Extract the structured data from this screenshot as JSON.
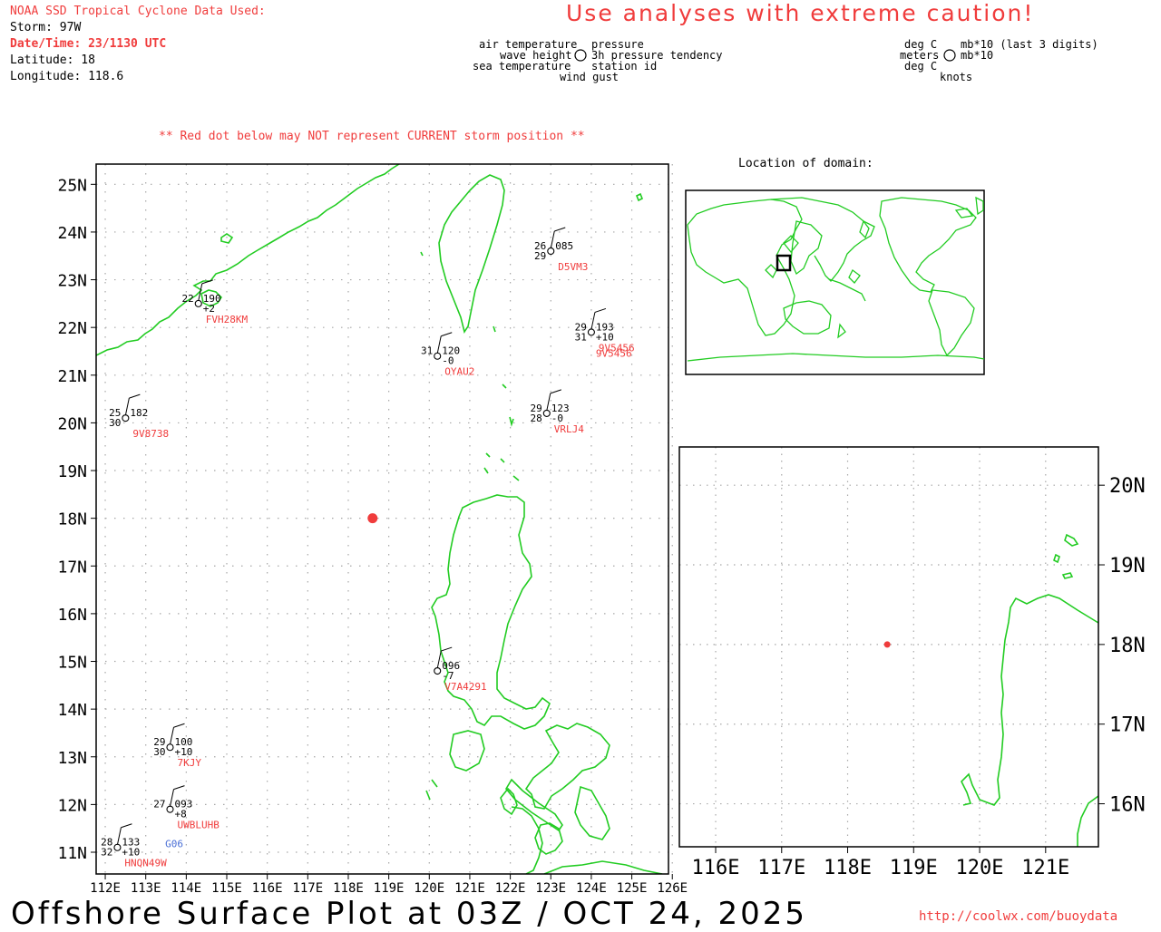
{
  "header": {
    "source": "NOAA SSD Tropical Cyclone Data Used:",
    "storm": "Storm: 97W",
    "datetime": "Date/Time: 23/1130 UTC",
    "latitude": "Latitude: 18",
    "longitude": "Longitude: 118.6",
    "warning": "Use analyses with extreme caution!"
  },
  "legend": {
    "air_temperature": "air temperature",
    "wave_height": "wave height",
    "sea_temperature": "sea temperature",
    "pressure": "pressure",
    "pressure_tendency": "3h pressure tendency",
    "station_id": "station id",
    "wind_gust": "wind gust",
    "unit_deg_c_1": "deg C",
    "unit_meters": "meters",
    "unit_deg_c_2": "deg C",
    "unit_mb_last3": "mb*10 (last 3 digits)",
    "unit_mb": "mb*10",
    "unit_knots": "knots"
  },
  "notice": "** Red dot below may NOT represent CURRENT storm position **",
  "inset_title": "Location of domain:",
  "storm_position": {
    "lat": 18.0,
    "lon": 118.6,
    "color": "#f03c3c"
  },
  "main_map": {
    "lat_labels": [
      "25N",
      "24N",
      "23N",
      "22N",
      "21N",
      "20N",
      "19N",
      "18N",
      "17N",
      "16N",
      "15N",
      "14N",
      "13N",
      "12N",
      "11N"
    ],
    "lon_labels": [
      "112E",
      "113E",
      "114E",
      "115E",
      "116E",
      "117E",
      "118E",
      "119E",
      "120E",
      "121E",
      "122E",
      "123E",
      "124E",
      "125E",
      "126E"
    ]
  },
  "zoom_map": {
    "lat_labels": [
      "20N",
      "19N",
      "18N",
      "17N",
      "16N"
    ],
    "lon_labels": [
      "116E",
      "117E",
      "118E",
      "119E",
      "120E",
      "121E"
    ]
  },
  "stations": [
    {
      "id": "D5VM3",
      "lat": 23.6,
      "lon": 123.0,
      "air": "26",
      "sea": "29",
      "pressure": "085",
      "tendency": "",
      "wave": ""
    },
    {
      "id": "FVH28KM",
      "lat": 22.5,
      "lon": 114.3,
      "air": "22",
      "sea": "",
      "pressure": "190",
      "tendency": "+2",
      "wave": ""
    },
    {
      "id": "9V5456",
      "lat": 21.9,
      "lon": 124.0,
      "air": "29",
      "sea": "31",
      "pressure": "193",
      "tendency": "+10",
      "wave": ""
    },
    {
      "id": "9V5456",
      "lat": 21.9,
      "lon": 124.0,
      "air": "",
      "sea": "",
      "pressure": "",
      "tendency": "",
      "wave": ""
    },
    {
      "id": "OYAU2",
      "lat": 21.4,
      "lon": 120.2,
      "air": "31",
      "sea": "",
      "pressure": "120",
      "tendency": "-0",
      "wave": ""
    },
    {
      "id": "VRLJ4",
      "lat": 20.2,
      "lon": 122.9,
      "air": "29",
      "sea": "28",
      "pressure": "123",
      "tendency": "-0",
      "wave": ""
    },
    {
      "id": "9V8738",
      "lat": 20.1,
      "lon": 112.5,
      "air": "25",
      "sea": "30",
      "pressure": "182",
      "tendency": "",
      "wave": ""
    },
    {
      "id": "V7A4291",
      "lat": 14.8,
      "lon": 120.2,
      "air": "",
      "sea": "",
      "pressure": "096",
      "tendency": "-7",
      "wave": ""
    },
    {
      "id": "7KJY",
      "lat": 13.2,
      "lon": 113.6,
      "air": "29",
      "sea": "30",
      "pressure": "100",
      "tendency": "+10",
      "wave": ""
    },
    {
      "id": "UWBLUHB",
      "lat": 11.9,
      "lon": 113.6,
      "air": "27",
      "sea": "",
      "pressure": "093",
      "tendency": "+8",
      "wave": ""
    },
    {
      "id": "G06",
      "lat": 11.5,
      "lon": 113.3,
      "air": "",
      "sea": "",
      "pressure": "",
      "tendency": "",
      "wave": ""
    },
    {
      "id": "HNQN49W",
      "lat": 11.1,
      "lon": 112.3,
      "air": "28",
      "sea": "32",
      "pressure": "133",
      "tendency": "+10",
      "wave": ""
    }
  ],
  "footer": {
    "title": "Offshore Surface Plot at 03Z / OCT 24, 2025",
    "url": "http://coolwx.com/buoydata"
  },
  "colors": {
    "land": "#22cc22",
    "red": "#f03c3c",
    "blue": "#4a6fd6",
    "grid": "#a8a8a8"
  }
}
